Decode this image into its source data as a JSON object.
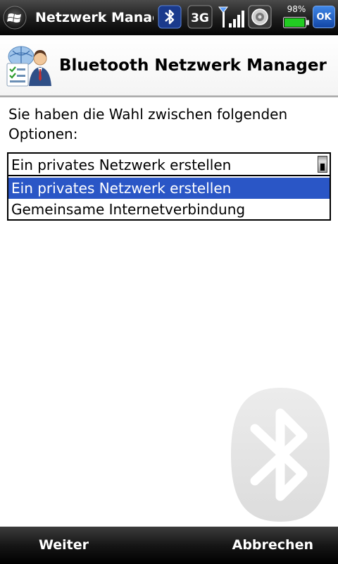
{
  "statusbar": {
    "app_title": "Netzwerk Manager",
    "network_type": "3G",
    "battery_percent": "98%",
    "battery_level": 0.98,
    "ok_label": "OK",
    "icons": [
      "windows-start-icon",
      "bluetooth-icon",
      "3g-icon",
      "signal-strength-icon",
      "speaker-icon",
      "battery-icon"
    ]
  },
  "header": {
    "title": "Bluetooth Netzwerk Manager",
    "icon": "network-manager-icon"
  },
  "main": {
    "prompt": "Sie haben die Wahl zwischen folgenden Optionen:",
    "dropdown": {
      "selected_value": "Ein privates Netzwerk erstellen",
      "options": [
        {
          "label": "Ein privates Netzwerk erstellen",
          "highlighted": true
        },
        {
          "label": "Gemeinsame Internetverbindung",
          "highlighted": false
        }
      ]
    },
    "watermark_icon": "bluetooth-watermark-icon"
  },
  "softkeys": {
    "left": "Weiter",
    "right": "Abbrechen"
  },
  "colors": {
    "selection": "#2a56c6",
    "ok_button": "#1f5ec9",
    "battery": "#22cc22"
  }
}
